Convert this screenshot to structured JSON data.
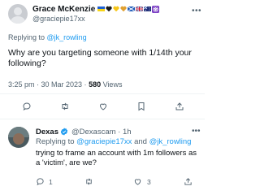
{
  "main_tweet": {
    "display_name": "Grace McKenzie",
    "handle": "@graciepie17xx",
    "replying_label": "Replying to ",
    "replying_to": "@jk_rowling",
    "text": "Why are you targeting someone with 1/14th your following?",
    "time": "3:25 pm · 30 Mar 2023 · ",
    "views_count": "580",
    "views_label": " Views",
    "emojis": [
      "ukraine-flag",
      "black-heart",
      "yellow-heart",
      "gold-heart",
      "scotland-flag",
      "uk-flag",
      "australia-flag",
      "atom-symbol"
    ],
    "actions": [
      "reply-icon",
      "retweet-icon",
      "like-icon",
      "bookmark-icon",
      "share-icon"
    ]
  },
  "reply_tweet": {
    "display_name": "Dexas",
    "verified": true,
    "handle": "@Dexascam · 1h",
    "replying_label": "Replying to ",
    "replying_to_1": "@graciepie17xx",
    "replying_and": " and ",
    "replying_to_2": "@jk_rowling",
    "text": "trying to frame an account with 1m followers as a 'victim', are we?",
    "reply_count": "1",
    "retweet_count": "",
    "like_count": "3"
  },
  "colors": {
    "text": "#0f1419",
    "secondary": "#536471",
    "link": "#1d9bf0",
    "divider": "#eff3f4",
    "verified": "#1d9bf0"
  }
}
